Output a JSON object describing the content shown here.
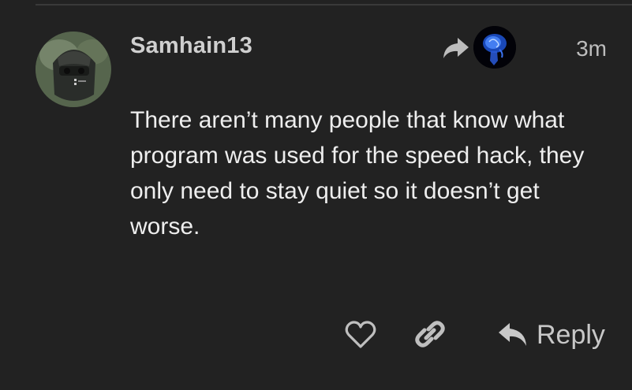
{
  "post": {
    "username": "Samhain13",
    "timestamp": "3m",
    "body": "There aren’t many people that know what program was used for the speed hack, they only need to stay quiet so it doesn’t get worse."
  },
  "actions": {
    "reply_label": "Reply",
    "like_icon": "heart-icon",
    "link_icon": "link-icon",
    "reply_icon": "reply-arrow-icon"
  },
  "colors": {
    "background": "#222222",
    "text": "#eeeeee",
    "muted": "#bdbdbd",
    "icon": "#bfbfbf"
  }
}
